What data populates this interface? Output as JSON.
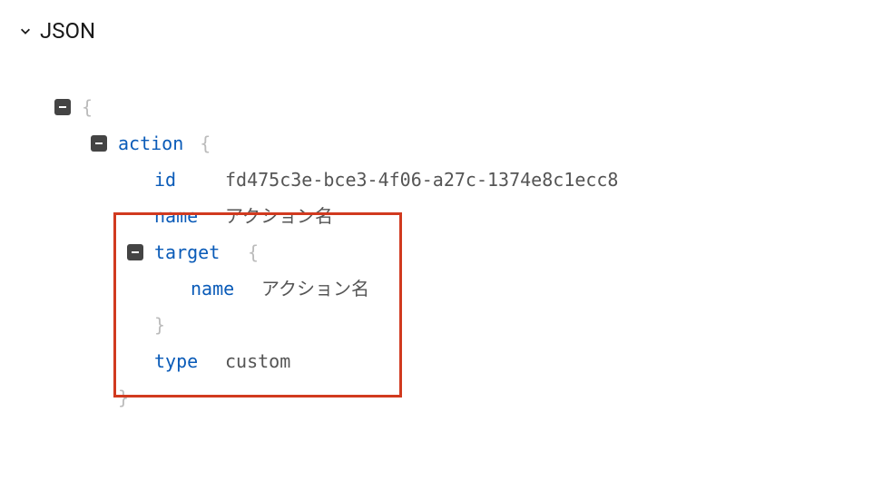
{
  "section": {
    "title": "JSON"
  },
  "json": {
    "action_key": "action",
    "id_key": "id",
    "id_value": "fd475c3e-bce3-4f06-a27c-1374e8c1ecc8",
    "name_key": "name",
    "name_value": "アクション名",
    "target_key": "target",
    "target_name_key": "name",
    "target_name_value": "アクション名",
    "type_key": "type",
    "type_value": "custom",
    "brace_open": "{",
    "brace_close": "}"
  }
}
